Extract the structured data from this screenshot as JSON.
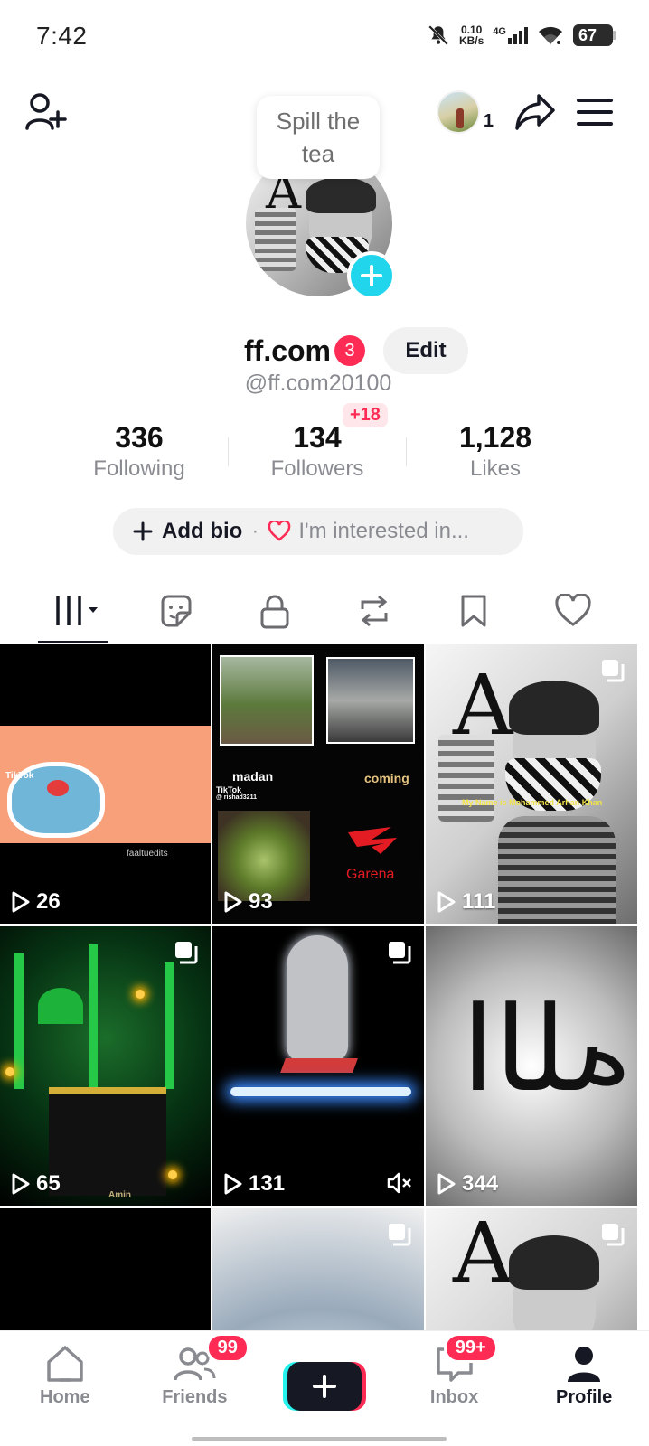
{
  "status_bar": {
    "time": "7:42",
    "net_speed_value": "0.10",
    "net_speed_unit": "KB/s",
    "network": "4G",
    "battery": "67"
  },
  "header": {
    "tooltip": "Spill the tea",
    "friend_count": "1"
  },
  "profile": {
    "display_name": "ff.com",
    "name_badge": "3",
    "edit_label": "Edit",
    "username": "@ff.com20100"
  },
  "stats": {
    "following": {
      "value": "336",
      "label": "Following"
    },
    "followers": {
      "value": "134",
      "label": "Followers",
      "delta": "+18"
    },
    "likes": {
      "value": "1,128",
      "label": "Likes"
    }
  },
  "bio": {
    "add_bio": "Add bio",
    "separator": "·",
    "interest": "I'm interested in..."
  },
  "tabs": [
    "videos-grid",
    "stickers",
    "private-lock",
    "reposts",
    "favorites",
    "liked"
  ],
  "videos": [
    {
      "views": "26",
      "text": [
        "TikTok",
        "faaltuedits"
      ]
    },
    {
      "views": "93",
      "text": [
        "madan",
        "coming",
        "TikTok",
        "@ rishad3211",
        "Garena"
      ]
    },
    {
      "views": "111",
      "multi": true,
      "text": [
        "My Name is Mohammed Arhan Khan"
      ]
    },
    {
      "views": "65",
      "multi": true,
      "text": [
        "Amin"
      ]
    },
    {
      "views": "131",
      "multi": true,
      "muted": true
    },
    {
      "views": "344"
    },
    {
      "views": ""
    },
    {
      "views": "",
      "multi": true
    },
    {
      "views": "",
      "multi": true
    }
  ],
  "bottom_nav": {
    "home": "Home",
    "friends": "Friends",
    "friends_badge": "99",
    "inbox": "Inbox",
    "inbox_badge": "99+",
    "profile": "Profile"
  },
  "colors": {
    "accent": "#fe2c55",
    "cyan": "#20d5ec",
    "text_primary": "#161823",
    "text_secondary": "#8a8b91"
  }
}
